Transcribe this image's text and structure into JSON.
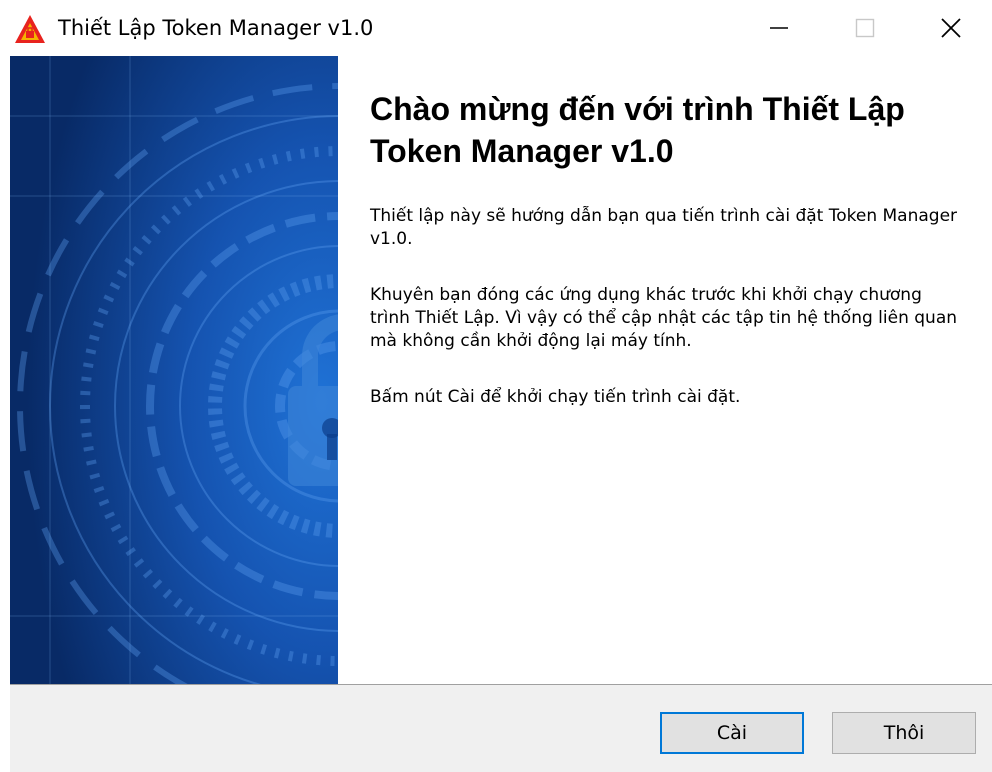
{
  "window": {
    "title": "Thiết Lập Token Manager v1.0",
    "icons": {
      "app": "installer-app-icon",
      "minimize": "minimize-icon",
      "maximize": "maximize-icon",
      "close": "close-icon"
    }
  },
  "banner": {
    "image": "security-padlock-banner"
  },
  "content": {
    "heading": "Chào mừng đến với trình Thiết Lập Token Manager v1.0",
    "paragraph1": "Thiết lập này sẽ hướng dẫn bạn qua tiến trình cài đặt Token Manager v1.0.",
    "paragraph2": "Khuyên bạn đóng các ứng dụng khác trước khi khởi chạy chương trình Thiết Lập. Vì vậy có thể cập nhật các tập tin hệ thống liên quan mà không cần khởi động lại máy tính.",
    "paragraph3": "Bấm nút Cài để khởi chạy tiến trình cài đặt."
  },
  "buttons": {
    "install_label": "Cài",
    "cancel_label": "Thôi"
  },
  "colors": {
    "banner_base": "#0c3d8a",
    "focus_border": "#0078d7",
    "icon_red": "#e8231e",
    "icon_gold": "#f5b400"
  }
}
